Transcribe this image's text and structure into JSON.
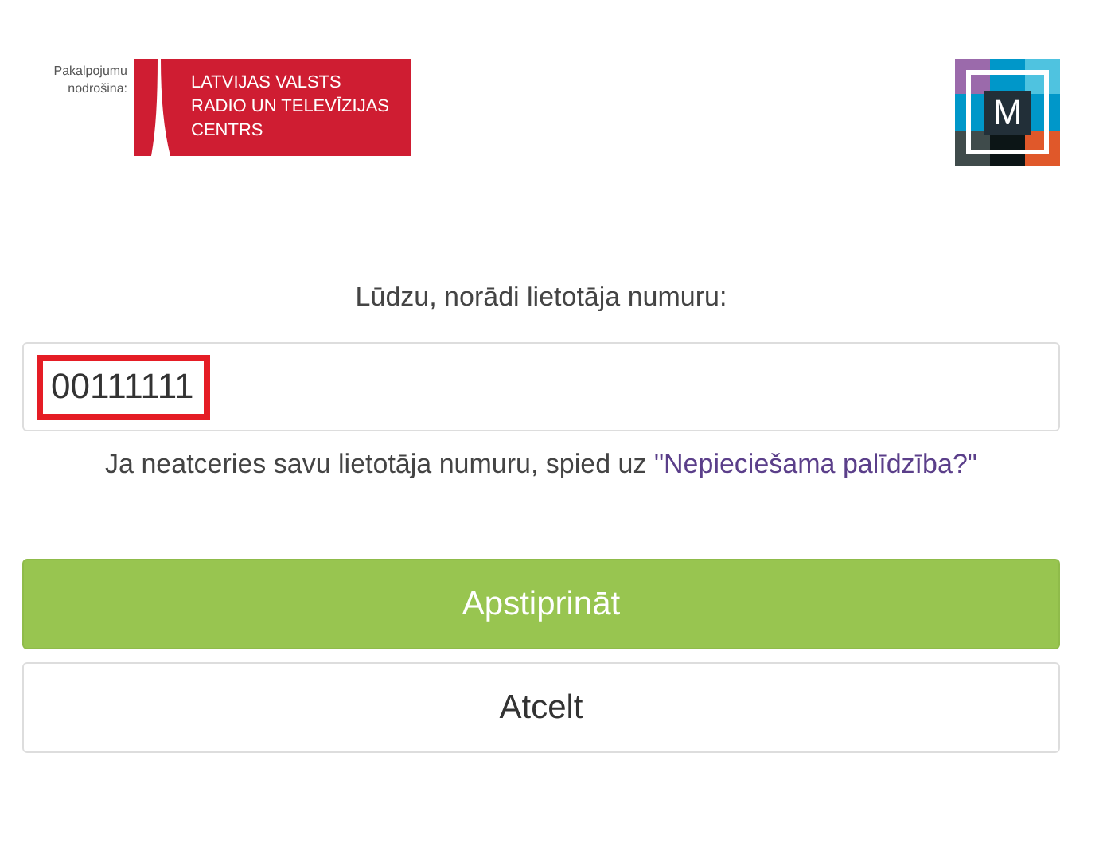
{
  "header": {
    "provider_caption": "Pakalpojumu nodrošina:",
    "provider_logo_lines": [
      "LATVIJAS VALSTS",
      "RADIO UN TELEVĪZIJAS",
      "CENTRS"
    ],
    "app_logo_letter": "M"
  },
  "form": {
    "prompt": "Lūdzu, norādi lietotāja numuru:",
    "field": {
      "value": "00111111",
      "highlighted": true
    },
    "help_text": "Ja neatceries savu lietotāja numuru, spied uz ",
    "help_link": "\"Nepieciešama palīdzība?\""
  },
  "buttons": [
    {
      "label": "Apstiprināt",
      "kind": "primary"
    },
    {
      "label": "Atcelt",
      "kind": "secondary"
    }
  ]
}
